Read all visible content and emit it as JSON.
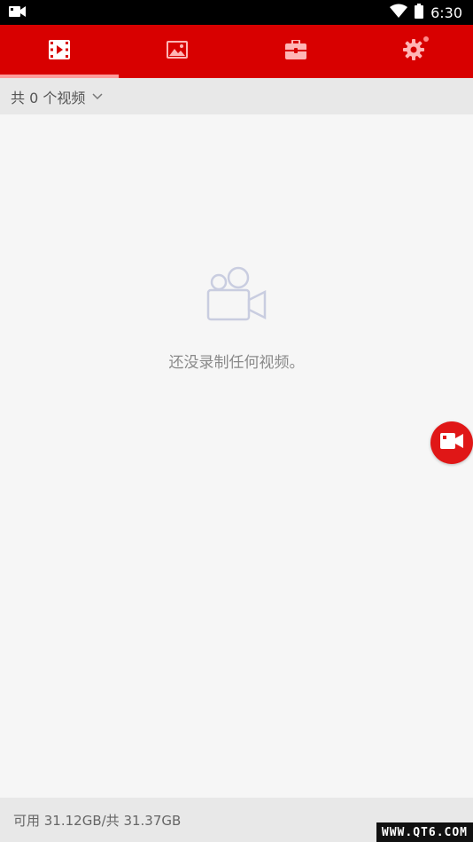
{
  "status_bar": {
    "time": "6:30",
    "left_icon": "video-recording-notification-icon",
    "right_icons": [
      "wifi-icon",
      "battery-icon"
    ]
  },
  "tabs": [
    {
      "icon": "film-video-icon",
      "active": true
    },
    {
      "icon": "image-icon",
      "active": false
    },
    {
      "icon": "toolbox-icon",
      "active": false
    },
    {
      "icon": "gear-icon",
      "active": false,
      "badge": true
    }
  ],
  "filter": {
    "label": "共 0 个视频",
    "icon": "chevron-down-icon"
  },
  "empty_state": {
    "icon": "video-camera-icon",
    "message": "还没录制任何视频。"
  },
  "fab": {
    "icon": "record-camera-icon"
  },
  "storage": {
    "text": "可用 31.12GB/共 31.37GB"
  },
  "watermark": "WWW.QT6.COM",
  "colors": {
    "primary": "#d80000",
    "fab": "#e01717",
    "tab_indicator": "#ff9a9a",
    "background": "#f6f6f6",
    "bar_gray": "#e8e8e8",
    "empty_icon": "#c9cde0"
  }
}
